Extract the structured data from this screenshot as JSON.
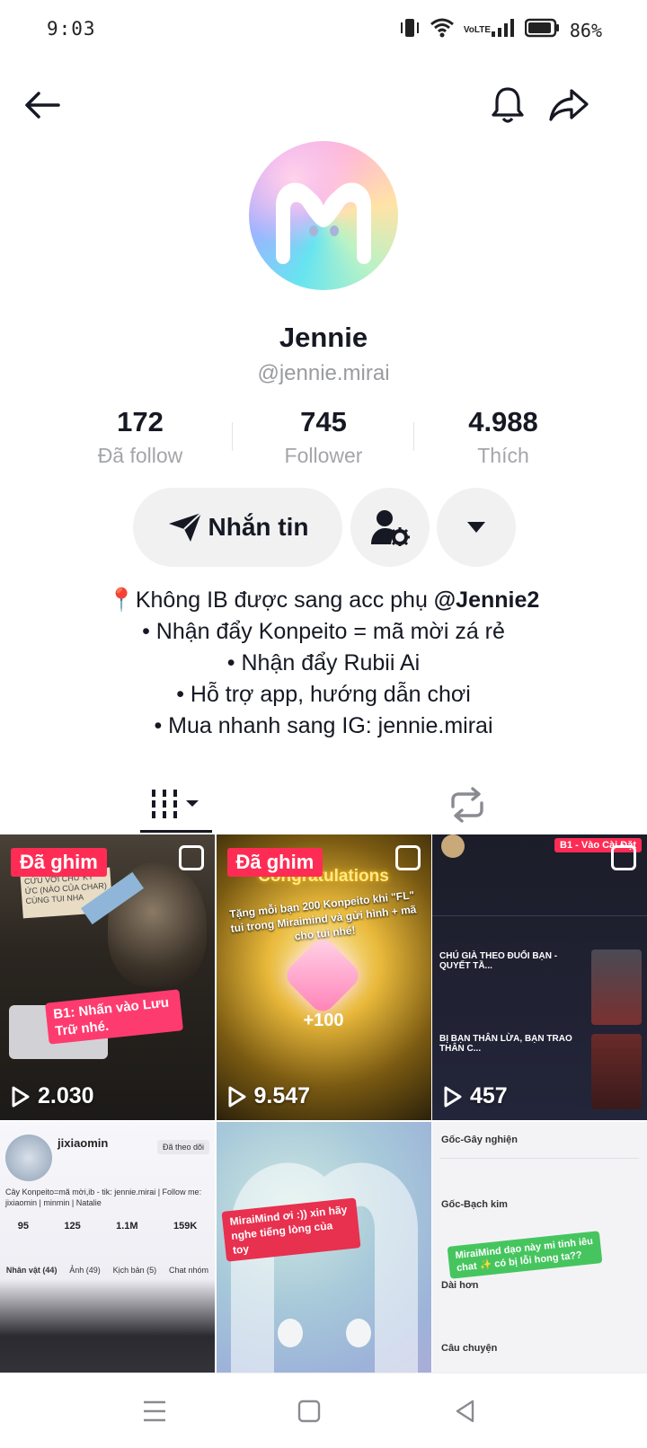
{
  "status": {
    "time": "9:03",
    "battery": "86%",
    "network": "VoLTE"
  },
  "profile": {
    "display_name": "Jennie",
    "username": "@jennie.mirai",
    "avatar_letter": "M"
  },
  "stats": [
    {
      "value": "172",
      "label": "Đã follow"
    },
    {
      "value": "745",
      "label": "Follower"
    },
    {
      "value": "4.988",
      "label": "Thích"
    }
  ],
  "actions": {
    "message_label": "Nhắn tin"
  },
  "bio": {
    "line1_prefix": "📍Không IB được sang acc phụ ",
    "line1_mention": "@Jennie2",
    "line2": "• Nhận đẩy Konpeito = mã mời zá rẻ",
    "line3": "• Nhận đẩy Rubii Ai",
    "line4": "• Hỗ trợ app, hướng dẫn chơi",
    "line5": "• Mua nhanh sang IG: jennie.mirai"
  },
  "videos": [
    {
      "pinned": "Đã ghim",
      "views": "2.030",
      "sticker": "B1: Nhấn vào Lưu Trữ nhé.",
      "note": "CỨU VỚI CHỨ KÝ ỨC (NÀO CỦA CHAR) CÙNG TUI NHA"
    },
    {
      "pinned": "Đã ghim",
      "views": "9.547",
      "headline": "Congratulations",
      "caption": "Tặng mỗi bạn 200 Konpeito khi \"FL\" tui trong Miraimind và gửi hình + mã cho tui nhé!",
      "amount": "+100"
    },
    {
      "views": "457",
      "header": "B1 - Vào Cài Đặt",
      "title": "CHÚ GIÀ THEO ĐUỔI BẠN - QUYẾT TẦ...",
      "title2": "BỊ BẠN THÂN LỪA, BẠN TRAO THÂN C..."
    },
    {
      "name": "jixiaomin",
      "follow_state": "Đã theo dõi",
      "bio": "Cây Konpeito=mã mời,ib - tik: jennie.mirai | Follow me: jixiaomin | minmin | Natalie",
      "counts": [
        "95",
        "125",
        "1.1M",
        "159K"
      ],
      "tabs": [
        "Nhân vật (44)",
        "Ảnh (49)",
        "Kịch bản (5)",
        "Chat nhóm"
      ]
    },
    {
      "sticker": "MiraiMind ơi :)) xin hãy nghe tiếng lòng của toy"
    },
    {
      "items": [
        "Gốc-Gây nghiện",
        "Gốc-Bạch kim",
        "Dài hơn",
        "Câu chuyện"
      ],
      "sticker": "MiraiMind dạo này mi tinh iêu chat ✨ có bị lỗi hong ta??"
    }
  ]
}
